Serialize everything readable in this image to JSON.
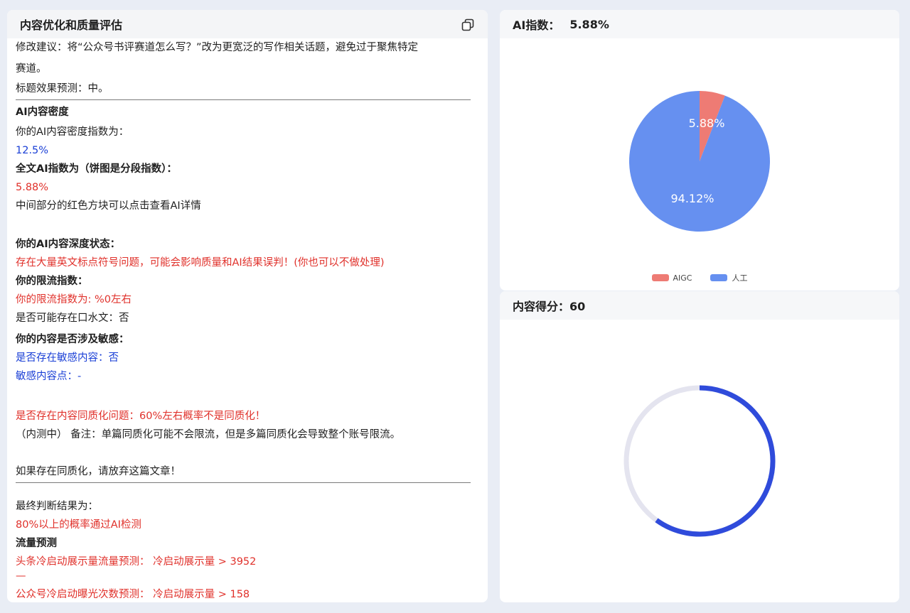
{
  "left": {
    "title": "内容优化和质量评估",
    "suggest_line1": "修改建议：将“公众号书评赛道怎么写？”改为更宽泛的写作相关话题，避免过于聚焦特定",
    "suggest_line2": "赛道。",
    "title_effect": "标题效果预测：中。",
    "ai_density_heading": "AI内容密度",
    "ai_density_label": "你的AI内容密度指数为：",
    "ai_density_value": "12.5%",
    "full_ai_heading": "全文AI指数为（饼图是分段指数）：",
    "full_ai_value": "5.88%",
    "click_hint": "中间部分的红色方块可以点击查看AI详情",
    "depth_heading": "你的AI内容深度状态：",
    "depth_value": "存在大量英文标点符号问题，可能会影响质量和AI结果误判！(你也可以不做处理)",
    "limit_heading": "你的限流指数：",
    "limit_value": "你的限流指数为: %0左右",
    "filler_text": "是否可能存在口水文：否",
    "sensitive_heading": "你的内容是否涉及敏感：",
    "sensitive_exists": "是否存在敏感内容：否",
    "sensitive_points": "敏感内容点：-",
    "homog_question": "是否存在内容同质化问题：60%左右概率不是同质化！",
    "homog_note": "（内测中） 备注：单篇同质化可能不会限流，但是多篇同质化会导致整个账号限流。",
    "homog_advice": "如果存在同质化，请放弃这篇文章！",
    "final_label": "最终判断结果为：",
    "final_value": "80%以上的概率通过AI检测",
    "traffic_heading": "流量预测",
    "toutiao_pred": "头条冷启动展示量流量预测： 冷启动展示量 > 3952",
    "dash": "—",
    "wechat_pred": "公众号冷启动曝光次数预测： 冷启动展示量 > 158"
  },
  "ai_panel": {
    "title": "AI指数：",
    "title_value": "5.88%",
    "legend_aigc": "AIGC",
    "legend_human": "人工"
  },
  "score_panel": {
    "title": "内容得分：60"
  },
  "chart_data": [
    {
      "type": "pie",
      "categories": [
        "AIGC",
        "人工"
      ],
      "values": [
        5.88,
        94.12
      ],
      "labels": [
        "5.88%",
        "94.12%"
      ],
      "colors": [
        "#ee7b74",
        "#6690f0"
      ],
      "legend": "bottom-center"
    },
    {
      "type": "gauge",
      "value": 60,
      "max": 100,
      "colors": {
        "fill": "#2f4bdb",
        "track": "#e4e4ef"
      }
    }
  ]
}
